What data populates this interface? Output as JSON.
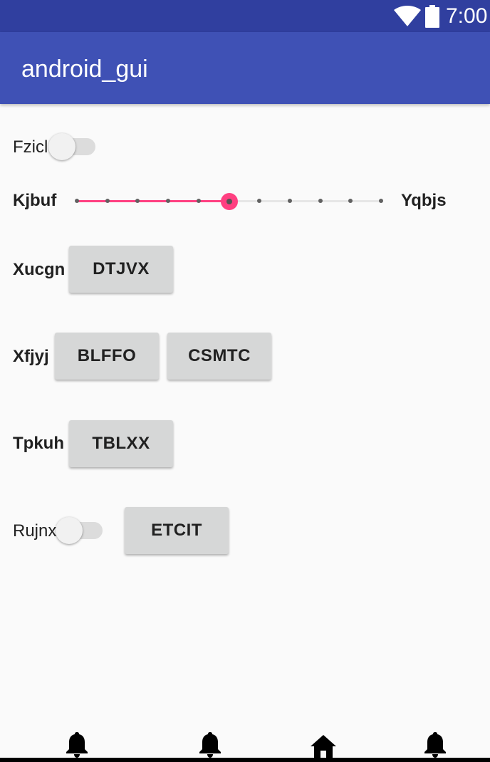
{
  "status_bar": {
    "time": "7:00",
    "wifi_icon": "wifi-icon",
    "battery_icon": "battery-icon",
    "color": "#303f9f"
  },
  "app_bar": {
    "title": "android_gui",
    "color": "#3f51b5"
  },
  "rows": {
    "fzicl": {
      "label": "Fzicl",
      "switch_on": false
    },
    "slider": {
      "left_label": "Kjbuf",
      "right_label": "Yqbjs",
      "steps": 10,
      "value": 5,
      "accent": "#ff4081"
    },
    "xucgn": {
      "label": "Xucgn",
      "button": "DTJVX"
    },
    "xfjyj": {
      "label": "Xfjyj",
      "button_1": "BLFFO",
      "button_2": "CSMTC"
    },
    "tpkuh": {
      "label": "Tpkuh",
      "button": "TBLXX"
    },
    "rujnx": {
      "label": "Rujnx",
      "switch_on": false,
      "button": "ETCIT"
    }
  },
  "bottom_nav": {
    "items": [
      {
        "icon": "bell-icon"
      },
      {
        "icon": "bell-icon"
      },
      {
        "icon": "home-icon"
      },
      {
        "icon": "bell-icon"
      }
    ]
  }
}
